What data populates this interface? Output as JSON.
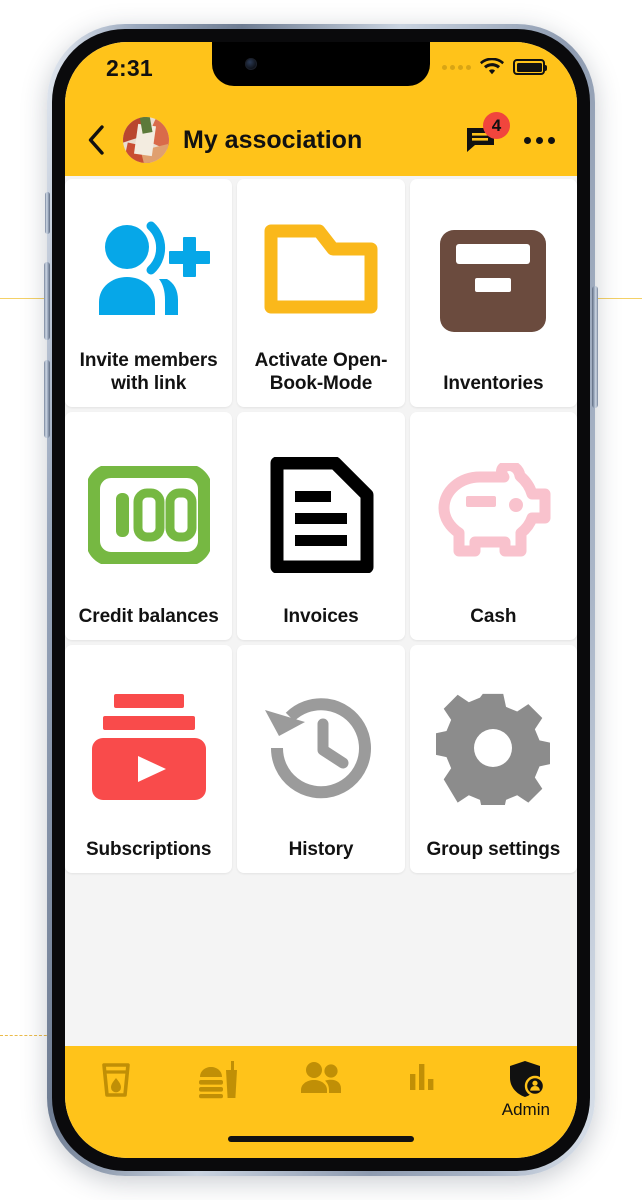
{
  "status_bar": {
    "time": "2:31",
    "signal_dots": 4,
    "wifi_icon": "wifi-icon",
    "battery_icon": "battery-full-icon"
  },
  "app_bar": {
    "back_icon": "chevron-left-icon",
    "avatar": "group-photo-avatar",
    "title": "My association",
    "chat_icon": "chat-bubble-icon",
    "badge_count": "4",
    "more_icon": "more-horizontal-icon"
  },
  "grid": {
    "tiles": [
      {
        "label": "Invite members with link",
        "icon": "person-add-icon",
        "color": "#06A7E8"
      },
      {
        "label": "Activate Open-Book-Mode",
        "icon": "folder-open-icon",
        "color": "#FAB81B"
      },
      {
        "label": "Inventories",
        "icon": "archive-box-icon",
        "color": "#6B4B3E"
      },
      {
        "label": "Credit balances",
        "icon": "hundred-credits-icon",
        "color": "#76B842"
      },
      {
        "label": "Invoices",
        "icon": "document-lines-icon",
        "color": "#000000"
      },
      {
        "label": "Cash",
        "icon": "piggy-bank-icon",
        "color": "#F9C2CD"
      },
      {
        "label": "Subscriptions",
        "icon": "subscriptions-play-icon",
        "color": "#F94B4B"
      },
      {
        "label": "History",
        "icon": "history-clock-icon",
        "color": "#9B9B9B"
      },
      {
        "label": "Group settings",
        "icon": "gear-icon",
        "color": "#8C8C8C"
      }
    ]
  },
  "bottom_nav": {
    "items": [
      {
        "label": "",
        "icon": "drink-glass-icon",
        "active": false
      },
      {
        "label": "",
        "icon": "food-burger-drink-icon",
        "active": false
      },
      {
        "label": "",
        "icon": "members-people-icon",
        "active": false
      },
      {
        "label": "",
        "icon": "bar-chart-icon",
        "active": false
      },
      {
        "label": "Admin",
        "icon": "admin-shield-person-icon",
        "active": true
      }
    ]
  },
  "theme": {
    "accent": "#FFC31A",
    "nav_inactive": "#C08F06",
    "nav_active": "#111111",
    "badge": "#F1453D",
    "tile_bg": "#FFFFFF",
    "content_bg": "#F4F4F4"
  }
}
